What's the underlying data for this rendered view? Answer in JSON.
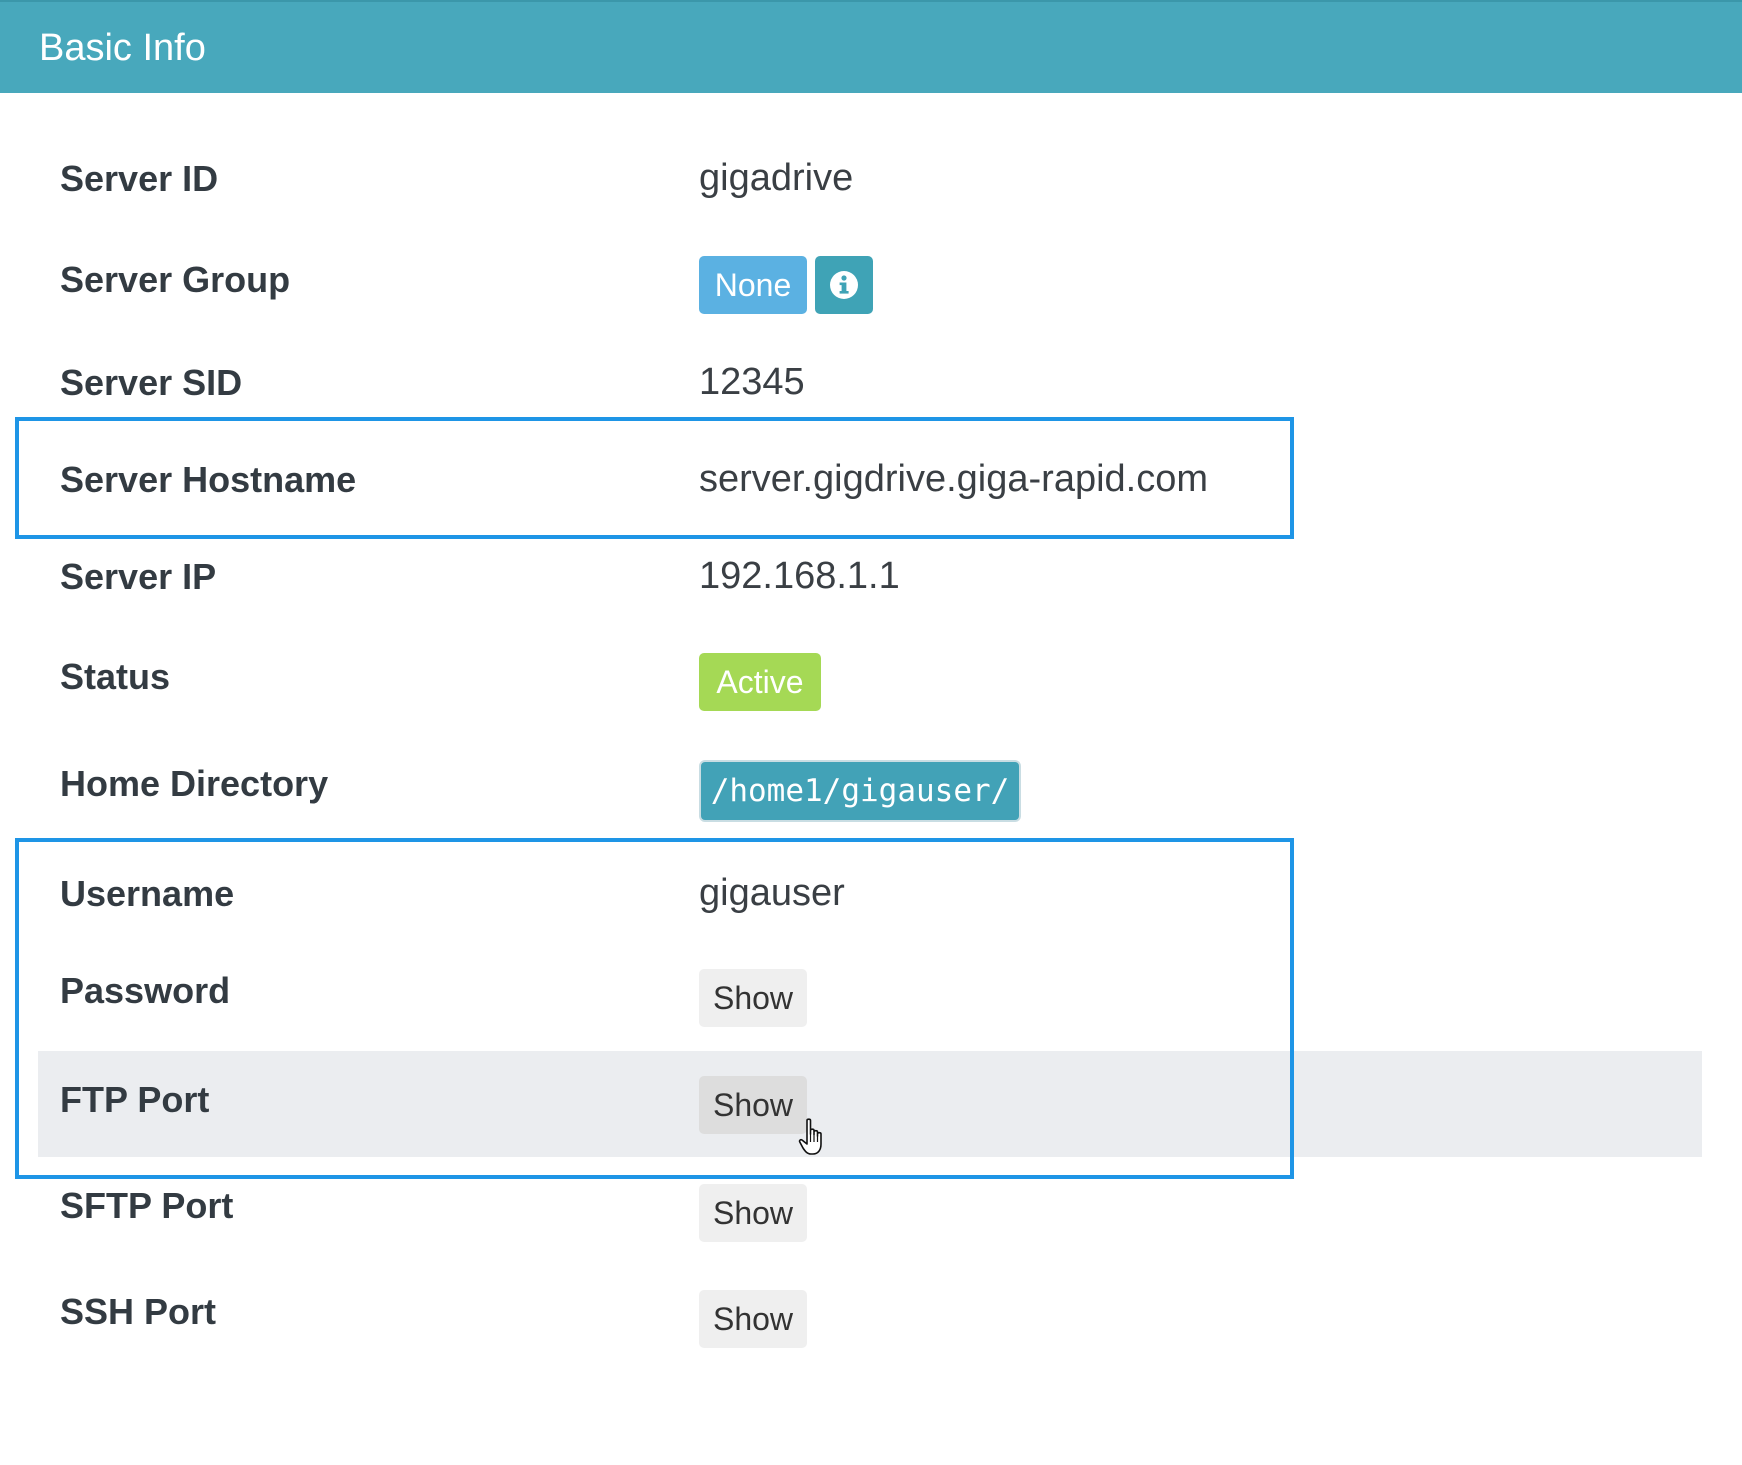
{
  "panel": {
    "title": "Basic Info"
  },
  "fields": {
    "server_id": {
      "label": "Server ID",
      "value": "gigadrive"
    },
    "server_group": {
      "label": "Server Group",
      "value": "None",
      "info_icon": "info-circle-icon"
    },
    "server_sid": {
      "label": "Server SID",
      "value": "12345"
    },
    "server_hostname": {
      "label": "Server Hostname",
      "value": "server.gigdrive.giga-rapid.com"
    },
    "server_ip": {
      "label": "Server IP",
      "value": "192.168.1.1"
    },
    "status": {
      "label": "Status",
      "value": "Active"
    },
    "home_directory": {
      "label": "Home Directory",
      "value": "/home1/gigauser/"
    },
    "username": {
      "label": "Username",
      "value": "gigauser"
    },
    "password": {
      "label": "Password",
      "button": "Show"
    },
    "ftp_port": {
      "label": "FTP Port",
      "button": "Show"
    },
    "sftp_port": {
      "label": "SFTP Port",
      "button": "Show"
    },
    "ssh_port": {
      "label": "SSH Port",
      "button": "Show"
    }
  },
  "colors": {
    "header": "#48a8bc",
    "badge_none": "#5bb1e2",
    "badge_info": "#3fa3b6",
    "badge_active": "#a5d955",
    "highlight": "#1e95e6",
    "row_hover": "#ebedf0"
  }
}
